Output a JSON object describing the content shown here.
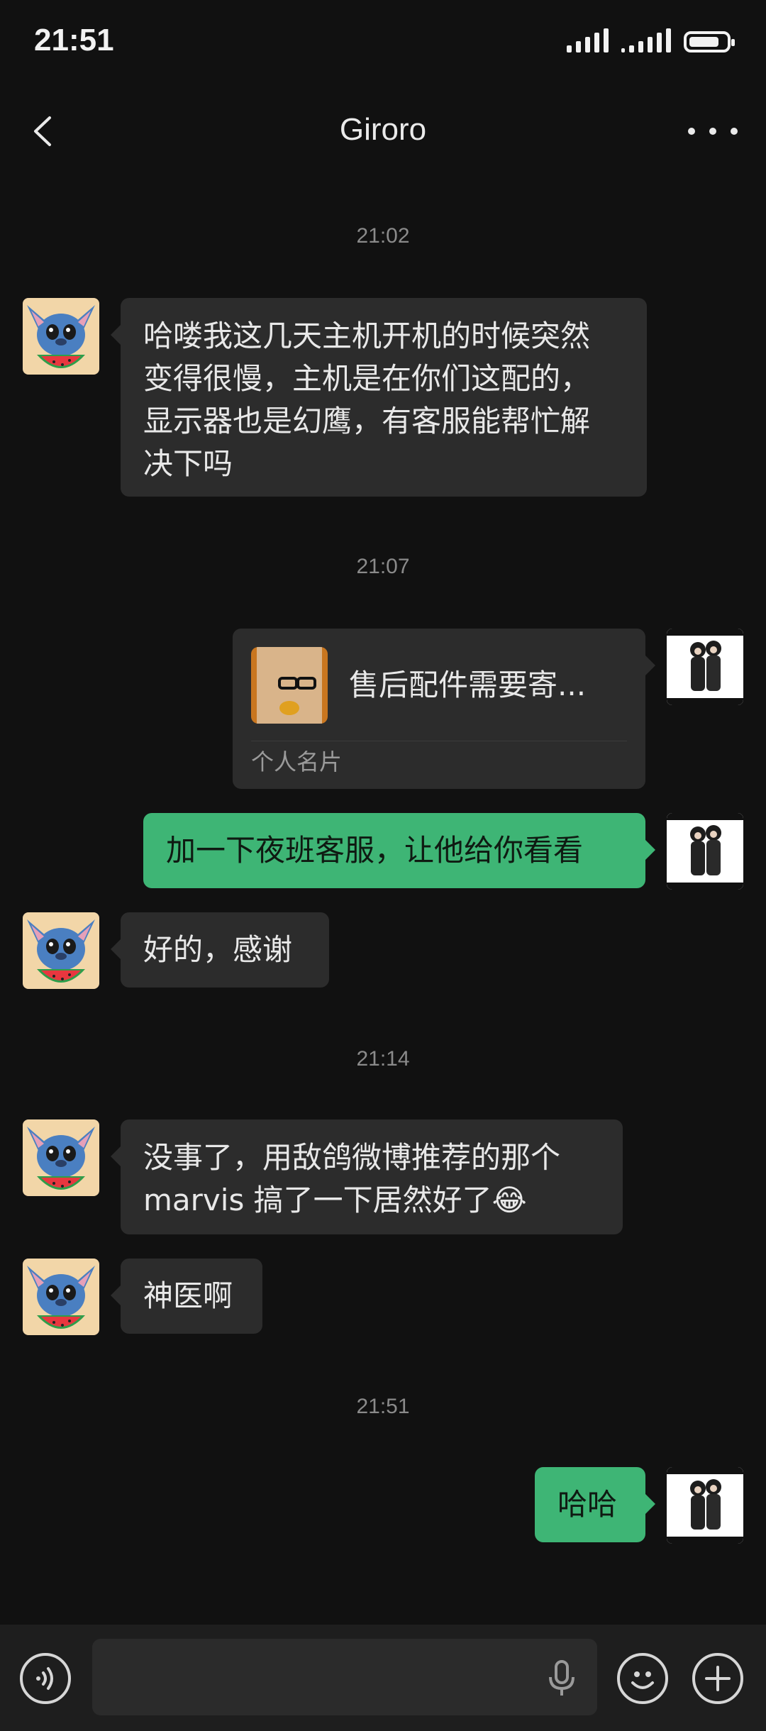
{
  "status_bar": {
    "time": "21:51"
  },
  "header": {
    "title": "Giroro"
  },
  "messages": {
    "ts1": "21:02",
    "m1": {
      "lines": [
        "哈喽我这几天主机开机的时候突然",
        "变得很慢，主机是在你们这配的，",
        "显示器也是幻鹰，有客服能帮忙解",
        "决下吗"
      ]
    },
    "ts2": "21:07",
    "card": {
      "name": "售后配件需要寄...",
      "label": "个人名片"
    },
    "m2": {
      "text": "加一下夜班客服，让他给你看看"
    },
    "m3": {
      "text": "好的，感谢"
    },
    "ts3": "21:14",
    "m4": {
      "lines": [
        "没事了，用敌鸽微博推荐的那个",
        "marvis 搞了一下居然好了😂"
      ]
    },
    "m5": {
      "text": "神医啊"
    },
    "ts4": "21:51",
    "m6": {
      "text": "哈哈"
    }
  },
  "input_bar": {
    "icons": [
      "voice-icon",
      "mic-icon",
      "emoji-icon",
      "plus-icon"
    ]
  },
  "colors": {
    "outgoing": "#3eb575",
    "incoming": "#2c2c2c",
    "background": "#111111"
  }
}
